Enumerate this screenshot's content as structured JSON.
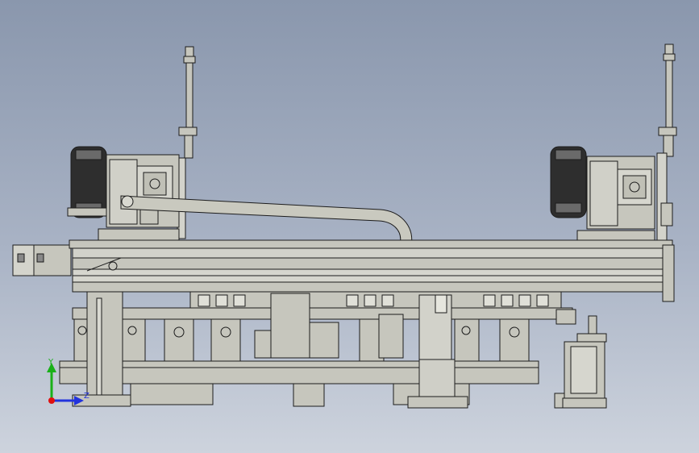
{
  "viewport": {
    "background_top": "#8a97ad",
    "background_bottom": "#cdd3dd"
  },
  "model": {
    "metal_color": "#c6c6bd",
    "dark_color": "#3a3a3a",
    "line_color": "#1c1c1c"
  },
  "triad": {
    "y_label": "Y",
    "z_label": "Z",
    "y_color": "#19b019",
    "z_color": "#2233dd",
    "origin_color": "#e01010"
  }
}
